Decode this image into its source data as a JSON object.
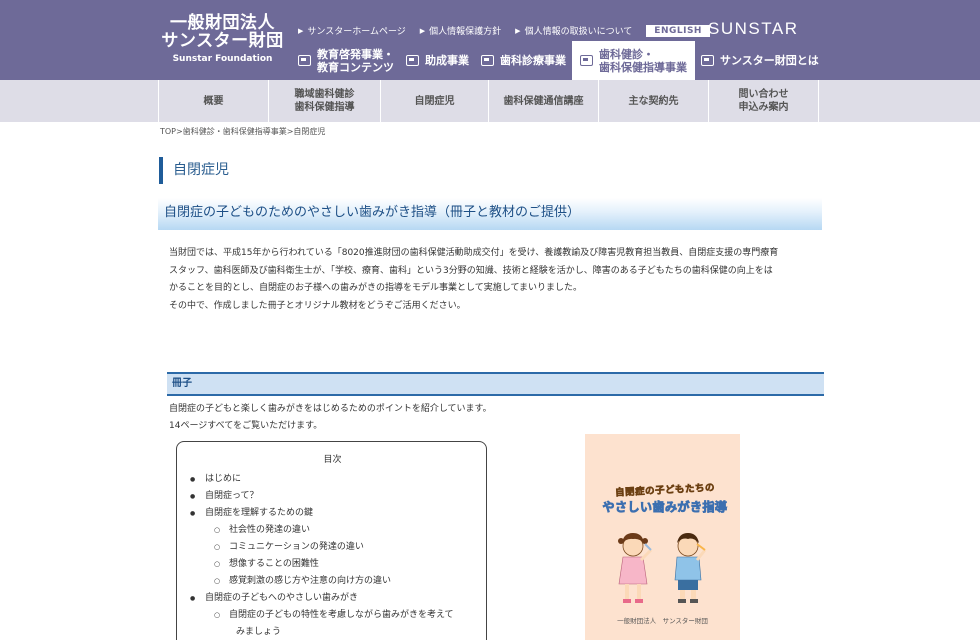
{
  "header": {
    "logo_jp_line1": "一般財団法人",
    "logo_jp_line2": "サンスター財団",
    "logo_en": "Sunstar Foundation",
    "brand": "SUNSTAR",
    "toplinks": [
      "サンスターホームページ",
      "個人情報保護方針",
      "個人情報の取扱いについて"
    ],
    "english_label": "ENGLISH",
    "mainnav": [
      {
        "line1": "教育啓発事業・",
        "line2": "教育コンテンツ"
      },
      {
        "line1": "助成事業",
        "line2": ""
      },
      {
        "line1": "歯科診療事業",
        "line2": ""
      },
      {
        "line1": "歯科健診・",
        "line2": "歯科保健指導事業"
      },
      {
        "line1": "サンスター財団とは",
        "line2": ""
      }
    ]
  },
  "subnav": [
    {
      "line1": "概要",
      "line2": ""
    },
    {
      "line1": "職域歯科健診",
      "line2": "歯科保健指導"
    },
    {
      "line1": "自閉症児",
      "line2": ""
    },
    {
      "line1": "歯科保健通信講座",
      "line2": ""
    },
    {
      "line1": "主な契約先",
      "line2": ""
    },
    {
      "line1": "問い合わせ",
      "line2": "申込み案内"
    }
  ],
  "breadcrumb": {
    "top": "TOP",
    "parent": "歯科健診・歯科保健指導事業",
    "current": "自閉症児",
    "sep": ">"
  },
  "page_title": "自閉症児",
  "section_heading": "自閉症の子どものためのやさしい歯みがき指導（冊子と教材のご提供）",
  "intro": {
    "line1": "当財団では、平成15年から行われている「8020推進財団の歯科保健活動助成交付」を受け、養護教諭及び障害児教育担当教員、自閉症支援の専門療育",
    "line2": "スタッフ、歯科医師及び歯科衛生士が、「学校、療育、歯科」という3分野の知識、技術と経験を活かし、障害のある子どもたちの歯科保健の向上をは",
    "line3": "かることを目的とし、自閉症のお子様への歯みがきの指導をモデル事業として実施してまいりました。",
    "line4": "その中で、作成しました冊子とオリジナル教材をどうぞご活用ください。"
  },
  "booklet": {
    "heading": "冊子",
    "desc1": "自閉症の子どもと楽しく歯みがきをはじめるためのポイントを紹介しています。",
    "desc2": "14ページすべてをご覧いただけます。",
    "toc_title": "目次",
    "toc": [
      {
        "level": 1,
        "text": "はじめに"
      },
      {
        "level": 1,
        "text": "自閉症って？"
      },
      {
        "level": 1,
        "text": "自閉症を理解するための鍵"
      },
      {
        "level": 2,
        "text": "社会性の発達の違い"
      },
      {
        "level": 2,
        "text": "コミュニケーションの発達の違い"
      },
      {
        "level": 2,
        "text": "想像することの困難性"
      },
      {
        "level": 2,
        "text": "感覚刺激の感じ方や注意の向け方の違い"
      },
      {
        "level": 1,
        "text": "自閉症の子どもへのやさしい歯みがき"
      },
      {
        "level": 2,
        "text": "自閉症の子どもの特性を考慮しながら歯みがきを考えて"
      },
      {
        "level": 3,
        "text": "みましょう"
      }
    ],
    "cover_title1": "自閉症の子どもたちの",
    "cover_title2": "やさしい歯みがき指導",
    "cover_footer": "一般財団法人　サンスター財団"
  },
  "colors": {
    "header_bg": "#6e6a98",
    "subnav_bg": "#dedde7",
    "accent_blue": "#1f5c99",
    "cover_bg": "#fde2cf"
  }
}
